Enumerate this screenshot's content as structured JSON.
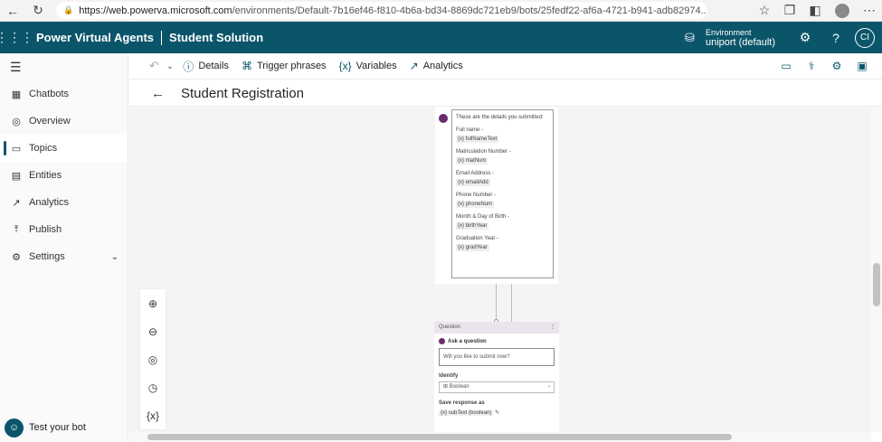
{
  "browser": {
    "url_domain": "https://web.powerva.microsoft.com",
    "url_path": "/environments/Default-7b16ef46-f810-4b6a-bd34-8869dc721eb9/bots/25fedf22-af6a-4721-b941-adb82974..."
  },
  "header": {
    "app_name": "Power Virtual Agents",
    "solution": "Student Solution",
    "env_label": "Environment",
    "env_value": "uniport (default)",
    "user_initials": "CI"
  },
  "sidebar": {
    "items": [
      {
        "label": "Chatbots",
        "icon": "grid-icon"
      },
      {
        "label": "Overview",
        "icon": "overview-icon"
      },
      {
        "label": "Topics",
        "icon": "topics-icon"
      },
      {
        "label": "Entities",
        "icon": "entities-icon"
      },
      {
        "label": "Analytics",
        "icon": "analytics-icon"
      },
      {
        "label": "Publish",
        "icon": "publish-icon"
      },
      {
        "label": "Settings",
        "icon": "settings-icon"
      }
    ],
    "active": "Topics",
    "test_bot": "Test your bot"
  },
  "toolbar": {
    "details": "Details",
    "trigger": "Trigger phrases",
    "variables": "Variables",
    "analytics": "Analytics"
  },
  "page": {
    "title": "Student Registration"
  },
  "message_node": {
    "intro": "These are the details you submitted:",
    "fields": [
      {
        "label": "Full name -",
        "var": "fullNameText"
      },
      {
        "label": "Matriculation Number -",
        "var": "matNum"
      },
      {
        "label": "Email Address -",
        "var": "emailAdd"
      },
      {
        "label": "Phone Number -",
        "var": "phoneNum"
      },
      {
        "label": "Month & Day of Birth -",
        "var": "birthYear"
      },
      {
        "label": "Graduation Year -",
        "var": "gradYear"
      }
    ],
    "var_tag": "{x}"
  },
  "question_node": {
    "header": "Question",
    "ask_label": "Ask a question",
    "question_text": "Will you like to submit now?",
    "identify_label": "Identify",
    "identify_value": "Boolean",
    "save_label": "Save response as",
    "save_var": "subText (boolean)"
  },
  "colors": {
    "brand": "#0b556a",
    "accent_purple": "#6b2c6b"
  }
}
